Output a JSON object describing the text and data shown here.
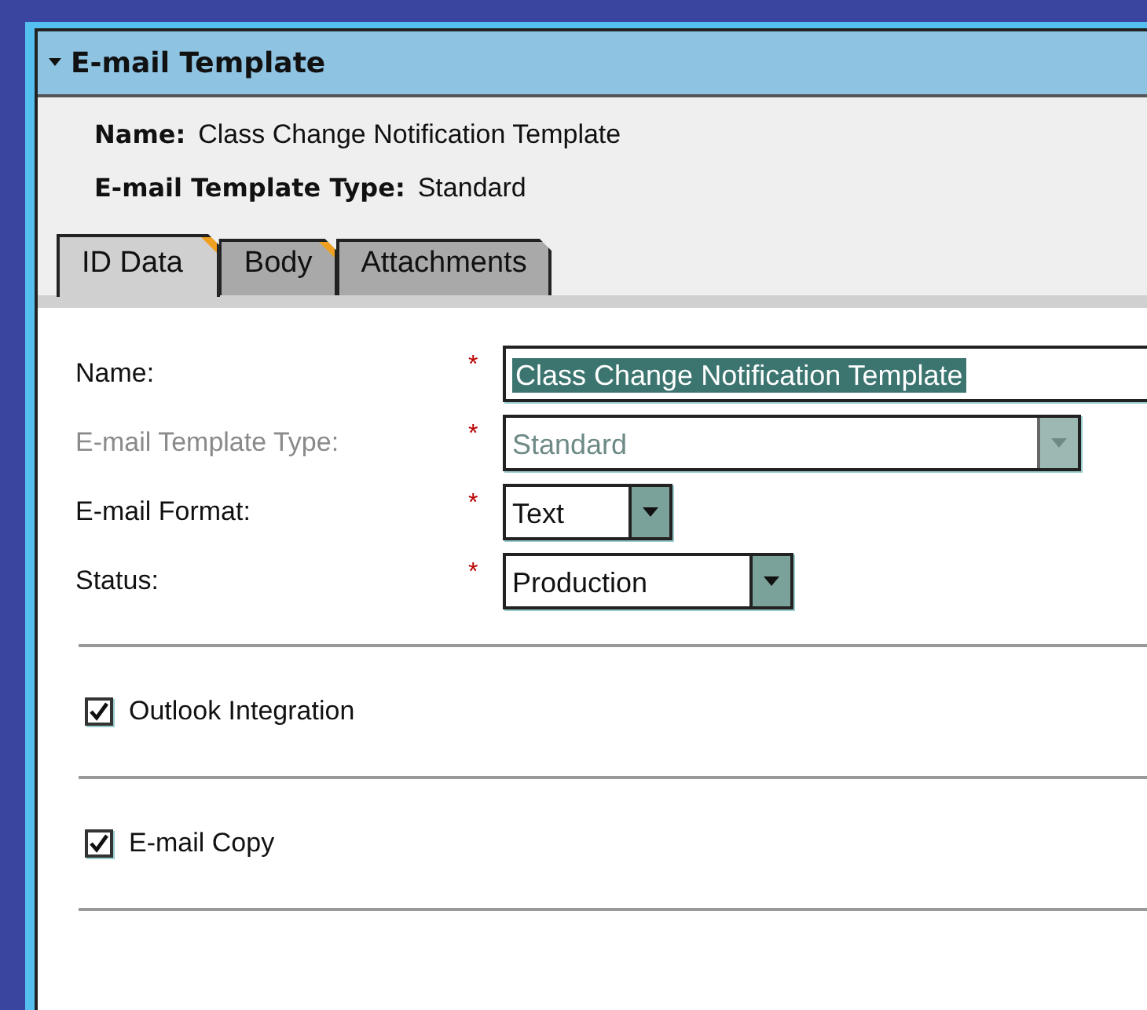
{
  "panel": {
    "title": "E-mail Template",
    "expanded": true
  },
  "summary": [
    {
      "label": "Name:",
      "value": "Class Change Notification Template"
    },
    {
      "label": "E-mail Template Type:",
      "value": "Standard"
    }
  ],
  "tabs": [
    {
      "label": "ID Data",
      "selected": true,
      "flagged": true
    },
    {
      "label": "Body",
      "selected": false,
      "flagged": true
    },
    {
      "label": "Attachments",
      "selected": false,
      "flagged": false
    }
  ],
  "fields": [
    {
      "kind": "text",
      "label": "Name:",
      "required_mark": "*",
      "value": "Class Change Notification Template",
      "highlighted": true,
      "disabled": false
    },
    {
      "kind": "select",
      "label": "E-mail Template Type:",
      "required_mark": "*",
      "value": "Standard",
      "highlighted": false,
      "disabled": true
    },
    {
      "kind": "select",
      "label": "E-mail Format:",
      "required_mark": "*",
      "value": "Text",
      "highlighted": false,
      "disabled": false
    },
    {
      "kind": "select",
      "label": "Status:",
      "required_mark": "*",
      "value": "Production",
      "highlighted": false,
      "disabled": false
    }
  ],
  "options": [
    {
      "label": "Outlook Integration",
      "checked": true
    },
    {
      "label": "E-mail Copy",
      "checked": true
    }
  ]
}
